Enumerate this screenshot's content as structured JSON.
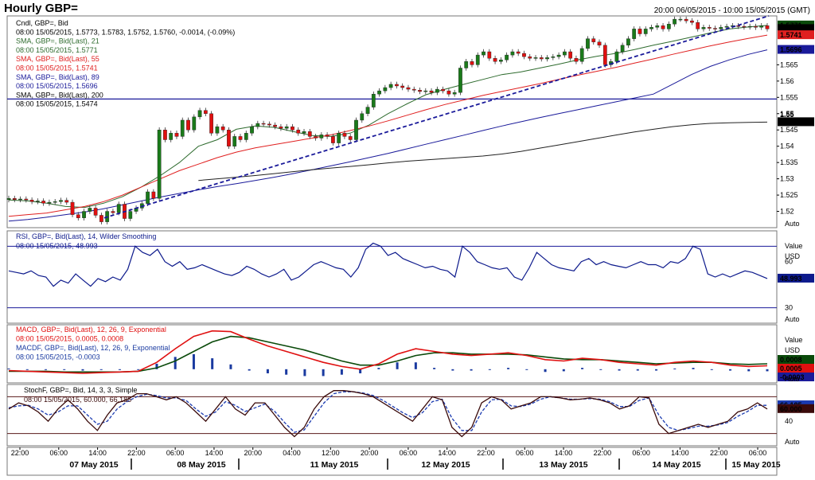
{
  "header": {
    "title": "Hourly GBP=",
    "range": "20:00 06/05/2015 - 10:00 15/05/2015 (GMT)"
  },
  "colors": {
    "up": "#1a7a1a",
    "down": "#e01010",
    "sma21": "#2e6b2e",
    "sma55": "#e02020",
    "sma89": "#1a1a9a",
    "sma200": "#222222",
    "rsi": "#0d1a8c",
    "macd": "#e01010",
    "macdf": "#0a4a0a",
    "hist": "#1a3aa0",
    "stochK": "#3a0a0a",
    "stochD": "#1a3ab0"
  },
  "legend": {
    "main": [
      "Cndl, GBP=, Bid",
      "08:00 15/05/2015, 1.5773, 1.5783, 1.5752, 1.5760, -0.0014, (-0.09%)",
      "SMA, GBP=, Bid(Last), 21",
      "08:00 15/05/2015, 1.5771",
      "SMA, GBP=, Bid(Last), 55",
      "08:00 15/05/2015, 1.5741",
      "SMA, GBP=, Bid(Last), 89",
      "08:00 15/05/2015, 1.5696",
      "SMA, GBP=, Bid(Last), 200",
      "08:00 15/05/2015, 1.5474"
    ],
    "rsi": [
      "RSI, GBP=, Bid(Last), 14, Wilder Smoothing",
      "08:00 15/05/2015, 48.993"
    ],
    "macd": [
      "MACD, GBP=, Bid(Last), 12, 26, 9, Exponential",
      "08:00 15/05/2015, 0.0005, 0.0008",
      "MACDF, GBP=, Bid(Last), 12, 26, 9, Exponential",
      "08:00 15/05/2015, -0.0003"
    ],
    "stoch": [
      "StochF, GBP=, Bid, 14, 3, 3, Simple",
      "08:00 15/05/2015, 60.000, 66.185"
    ]
  },
  "axis_labels": {
    "auto": "Auto",
    "value": "Value",
    "usd": "USD"
  },
  "chart_data": [
    {
      "type": "candlestick",
      "title": "Hourly GBP=",
      "x_start": "06/05/2015 20:00",
      "x_end": "15/05/2015 10:00",
      "ylim": [
        1.515,
        1.58
      ],
      "yticks": [
        "1.565",
        "1.56",
        "1.555",
        "1.55",
        "1.545",
        "1.54",
        "1.535",
        "1.53",
        "1.525",
        "1.52"
      ],
      "major_tick": "1.55",
      "xticks": [
        "22:00",
        "06:00",
        "14:00",
        "22:00",
        "06:00",
        "14:00",
        "20:00",
        "04:00",
        "12:00",
        "20:00",
        "06:00",
        "14:00",
        "22:00",
        "06:00",
        "14:00",
        "22:00",
        "06:00",
        "14:00",
        "22:00",
        "06:00"
      ],
      "dates": [
        "07 May 2015",
        "08 May 2015",
        "11 May 2015",
        "12 May 2015",
        "13 May 2015",
        "14 May 2015",
        "15 May 2015"
      ],
      "horizontal_line": 1.5545,
      "last_values": {
        "high": "1.5771",
        "close": "1.5760",
        "sma55": "1.5741",
        "sma89": "1.5696",
        "sma200": "1.5474"
      },
      "close": [
        1.524,
        1.5236,
        1.5238,
        1.5235,
        1.523,
        1.5232,
        1.5225,
        1.5228,
        1.523,
        1.5234,
        1.5228,
        1.519,
        1.518,
        1.52,
        1.521,
        1.5188,
        1.5168,
        1.52,
        1.5196,
        1.5222,
        1.5178,
        1.52,
        1.521,
        1.5224,
        1.526,
        1.524,
        1.545,
        1.542,
        1.544,
        1.543,
        1.548,
        1.545,
        1.549,
        1.551,
        1.55,
        1.544,
        1.546,
        1.545,
        1.54,
        1.543,
        1.542,
        1.544,
        1.546,
        1.547,
        1.5468,
        1.5465,
        1.546,
        1.5455,
        1.546,
        1.545,
        1.544,
        1.5445,
        1.543,
        1.5425,
        1.5435,
        1.543,
        1.541,
        1.544,
        1.543,
        1.542,
        1.548,
        1.55,
        1.552,
        1.556,
        1.557,
        1.558,
        1.559,
        1.5585,
        1.558,
        1.5575,
        1.5572,
        1.5568,
        1.557,
        1.5565,
        1.5575,
        1.557,
        1.556,
        1.5565,
        1.564,
        1.566,
        1.565,
        1.568,
        1.569,
        1.567,
        1.566,
        1.5665,
        1.568,
        1.569,
        1.5685,
        1.5675,
        1.567,
        1.5672,
        1.5668,
        1.5672,
        1.5675,
        1.568,
        1.569,
        1.567,
        1.566,
        1.57,
        1.573,
        1.572,
        1.571,
        1.565,
        1.566,
        1.569,
        1.571,
        1.573,
        1.576,
        1.5745,
        1.576,
        1.5765,
        1.577,
        1.576,
        1.5775,
        1.579,
        1.579,
        1.5785,
        1.578,
        1.576,
        1.5765,
        1.5762,
        1.576,
        1.5765,
        1.5768,
        1.577,
        1.5768,
        1.5766,
        1.5768,
        1.5765,
        1.577,
        1.576
      ],
      "series": [
        {
          "name": "SMA 21",
          "values": [
            1.5235,
            1.5232,
            1.5225,
            1.5215,
            1.5212,
            1.5225,
            1.5245,
            1.5275,
            1.531,
            1.535,
            1.54,
            1.542,
            1.5452,
            1.5462,
            1.5458,
            1.5445,
            1.5433,
            1.543,
            1.544,
            1.5465,
            1.55,
            1.553,
            1.5558,
            1.5575,
            1.559,
            1.5605,
            1.562,
            1.5628,
            1.564,
            1.5652,
            1.5665,
            1.5676,
            1.5685,
            1.5697,
            1.571,
            1.5722,
            1.5735,
            1.5748,
            1.576,
            1.5766,
            1.5771
          ]
        },
        {
          "name": "SMA 55",
          "values": [
            1.5185,
            1.519,
            1.5195,
            1.5205,
            1.5215,
            1.523,
            1.525,
            1.5275,
            1.53,
            1.5325,
            1.5345,
            1.5365,
            1.5382,
            1.5395,
            1.5405,
            1.5415,
            1.5425,
            1.5435,
            1.5448,
            1.5462,
            1.5478,
            1.5495,
            1.5512,
            1.5528,
            1.5542,
            1.5556,
            1.5568,
            1.558,
            1.5592,
            1.5605,
            1.5618,
            1.563,
            1.5642,
            1.5655,
            1.5668,
            1.5682,
            1.5695,
            1.5708,
            1.572,
            1.5731,
            1.5741
          ]
        },
        {
          "name": "SMA 89",
          "values": [
            1.517,
            1.5175,
            1.5182,
            1.519,
            1.5198,
            1.5208,
            1.522,
            1.5232,
            1.5244,
            1.5255,
            1.5266,
            1.5276,
            1.5285,
            1.5295,
            1.5305,
            1.5316,
            1.5328,
            1.534,
            1.5352,
            1.5365,
            1.5378,
            1.5392,
            1.5406,
            1.542,
            1.5434,
            1.5448,
            1.5462,
            1.5475,
            1.5488,
            1.55,
            1.5512,
            1.5524,
            1.5536,
            1.5548,
            1.556,
            1.559,
            1.562,
            1.5645,
            1.5665,
            1.5682,
            1.5696
          ]
        },
        {
          "name": "SMA 200",
          "values": [
            null,
            null,
            null,
            null,
            null,
            null,
            null,
            null,
            null,
            null,
            1.5295,
            1.53,
            1.5305,
            1.531,
            1.5316,
            1.5322,
            1.5328,
            1.5333,
            1.5338,
            1.5343,
            1.5349,
            1.5354,
            1.5358,
            1.5362,
            1.5366,
            1.537,
            1.5376,
            1.5384,
            1.5394,
            1.5404,
            1.5414,
            1.5424,
            1.5434,
            1.5444,
            1.5452,
            1.546,
            1.5466,
            1.547,
            1.5472,
            1.5473,
            1.5474
          ]
        }
      ],
      "trendline": [
        [
          1.518,
          1.58
        ]
      ]
    },
    {
      "type": "line",
      "title": "RSI, GBP=, Bid(Last), 14, Wilder Smoothing",
      "ylim": [
        20,
        80
      ],
      "yticks": [
        "60",
        "30"
      ],
      "levels": [
        70,
        30
      ],
      "last_value": "48.993",
      "series": [
        {
          "name": "RSI 14",
          "values": [
            54,
            53,
            52,
            54,
            51,
            50,
            44,
            48,
            46,
            52,
            48,
            44,
            49,
            47,
            50,
            48,
            55,
            70,
            66,
            64,
            68,
            60,
            57,
            60,
            55,
            56,
            58,
            56,
            54,
            52,
            51,
            53,
            57,
            55,
            52,
            50,
            52,
            55,
            48,
            50,
            54,
            58,
            60,
            58,
            56,
            55,
            50,
            56,
            68,
            72,
            70,
            64,
            66,
            62,
            60,
            58,
            56,
            57,
            55,
            54,
            50,
            70,
            66,
            60,
            58,
            56,
            55,
            56,
            50,
            48,
            56,
            66,
            62,
            58,
            56,
            55,
            54,
            60,
            62,
            58,
            60,
            58,
            57,
            56,
            58,
            60,
            58,
            58,
            56,
            60,
            59,
            62,
            70,
            68,
            52,
            50,
            52,
            50,
            52,
            54,
            53,
            51,
            49
          ]
        }
      ]
    },
    {
      "type": "line",
      "title": "MACD, GBP=, Bid(Last), 12, 26, 9, Exponential",
      "ylim": [
        -0.002,
        0.0065
      ],
      "last_values": {
        "macd": "0.0008",
        "signal": "0.0005",
        "hist": "-0.0003"
      },
      "series": [
        {
          "name": "MACD",
          "values": [
            -0.0002,
            -0.0003,
            -0.0004,
            -0.0005,
            -0.0006,
            -0.0005,
            -0.0004,
            -0.0003,
            0.001,
            0.003,
            0.0048,
            0.0056,
            0.0055,
            0.0044,
            0.0034,
            0.0026,
            0.0018,
            0.001,
            0.0004,
            0.0,
            0.0008,
            0.0022,
            0.003,
            0.0026,
            0.0022,
            0.002,
            0.0022,
            0.0024,
            0.002,
            0.0014,
            0.0012,
            0.0016,
            0.0014,
            0.001,
            0.0008,
            0.0006,
            0.001,
            0.0012,
            0.001,
            0.0006,
            0.0004,
            0.0005
          ]
        },
        {
          "name": "Signal",
          "values": [
            -0.0003,
            -0.0003,
            -0.0003,
            -0.0004,
            -0.0004,
            -0.0004,
            -0.0004,
            -0.0003,
            0.0002,
            0.0012,
            0.0026,
            0.004,
            0.0048,
            0.0046,
            0.004,
            0.0034,
            0.0028,
            0.002,
            0.0012,
            0.0006,
            0.0006,
            0.0012,
            0.002,
            0.0024,
            0.0024,
            0.0022,
            0.0022,
            0.0022,
            0.0021,
            0.0018,
            0.0015,
            0.0014,
            0.0014,
            0.0012,
            0.001,
            0.0008,
            0.0009,
            0.001,
            0.001,
            0.0008,
            0.0007,
            0.0008
          ]
        },
        {
          "name": "Histogram",
          "values": [
            0.0001,
            0.0,
            -0.0001,
            -0.0001,
            -0.0002,
            -0.0001,
            0.0,
            0.0,
            0.0008,
            0.0018,
            0.0022,
            0.0016,
            0.0007,
            -0.0002,
            -0.0006,
            -0.0008,
            -0.001,
            -0.001,
            -0.0008,
            -0.0006,
            0.0002,
            0.001,
            0.001,
            0.0002,
            -0.0002,
            -0.0002,
            0.0,
            0.0002,
            -0.0001,
            -0.0004,
            -0.0003,
            0.0002,
            0.0,
            -0.0002,
            -0.0002,
            -0.0002,
            0.0001,
            0.0002,
            0.0,
            -0.0002,
            -0.0003,
            -0.0003
          ]
        }
      ]
    },
    {
      "type": "line",
      "title": "StochF, GBP=, Bid, 14, 3, 3, Simple",
      "ylim": [
        0,
        100
      ],
      "yticks": [
        "40"
      ],
      "levels": [
        80,
        20
      ],
      "last_values": {
        "k": "60.000",
        "d": "66.185"
      },
      "series": [
        {
          "name": "%K",
          "values": [
            60,
            70,
            65,
            55,
            40,
            60,
            75,
            60,
            40,
            25,
            50,
            70,
            75,
            85,
            85,
            80,
            75,
            80,
            70,
            55,
            40,
            60,
            80,
            60,
            50,
            70,
            70,
            50,
            30,
            15,
            30,
            60,
            80,
            90,
            90,
            88,
            85,
            80,
            70,
            60,
            50,
            40,
            60,
            80,
            75,
            30,
            15,
            30,
            70,
            80,
            75,
            60,
            65,
            70,
            80,
            80,
            78,
            75,
            76,
            78,
            75,
            70,
            60,
            65,
            80,
            78,
            35,
            20,
            25,
            30,
            35,
            30,
            35,
            40,
            55,
            60,
            70,
            60
          ]
        },
        {
          "name": "%D",
          "values": [
            62,
            65,
            66,
            60,
            50,
            55,
            65,
            65,
            50,
            35,
            40,
            60,
            72,
            80,
            84,
            82,
            78,
            78,
            74,
            60,
            48,
            55,
            72,
            66,
            56,
            62,
            68,
            56,
            38,
            22,
            26,
            48,
            70,
            85,
            88,
            88,
            86,
            82,
            74,
            64,
            54,
            46,
            54,
            72,
            76,
            45,
            25,
            25,
            55,
            75,
            76,
            65,
            64,
            68,
            76,
            80,
            78,
            76,
            76,
            77,
            76,
            72,
            64,
            64,
            74,
            78,
            50,
            30,
            25,
            28,
            32,
            32,
            34,
            38,
            48,
            56,
            66,
            66
          ]
        }
      ]
    }
  ]
}
